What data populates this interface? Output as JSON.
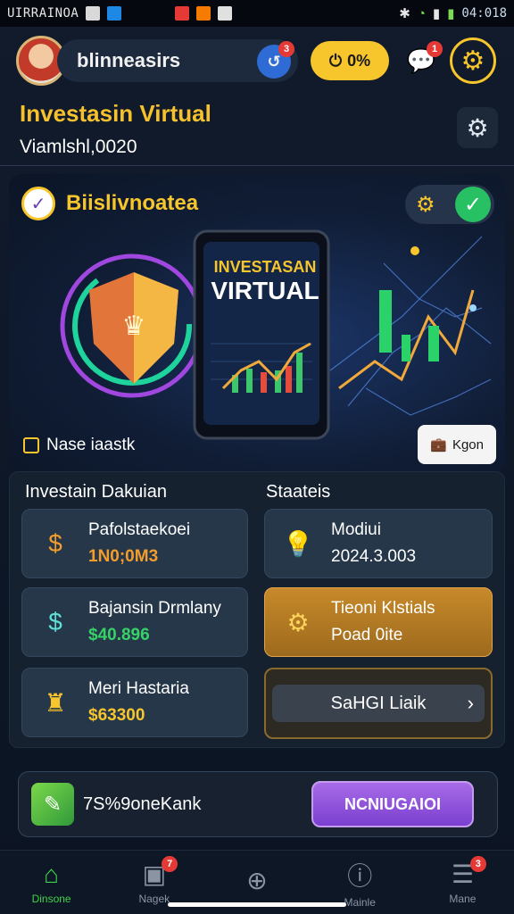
{
  "status_bar": {
    "carrier": "UIRRAINOA",
    "time": "04:018"
  },
  "header": {
    "username": "blinneasirs",
    "notif_badge": "3",
    "pill_label": "0%",
    "chat_badge": "1"
  },
  "title": {
    "main": "Investasin Virtual",
    "subtitle": "Viamlshl,0020"
  },
  "hero": {
    "title": "Biislivnoatea",
    "phone_line1": "INVESTASAN",
    "phone_line2": "VIRTUAL",
    "foot_left": "Nase iaastk",
    "foot_right": "Kgon"
  },
  "sections": {
    "left_title": "Investain Dakuian",
    "right_title": "Staateis"
  },
  "cards": [
    {
      "label": "Pafolstaekoei",
      "value": "1N0;0M3",
      "value_color": "#f29d2c"
    },
    {
      "label": "Bajansin Drmlany",
      "value": "$40.896",
      "value_color": "#37d167"
    },
    {
      "label": "Meri Hastaria",
      "value": "$63300",
      "value_color": "#f7c52c"
    },
    {
      "label": "Modiui",
      "value": "2024.3.003",
      "value_color": "#ffffff"
    },
    {
      "label": "Tieoni Klstials",
      "value": "Poad 0ite",
      "value_color": "#ffffff"
    },
    {
      "label": "SaHGI Liaik",
      "value": "",
      "value_color": "#ffffff"
    }
  ],
  "banner": {
    "text": "7S%9oneKank",
    "button": "NCNIUGAIOI"
  },
  "nav": [
    {
      "label": "Dinsone",
      "active": true
    },
    {
      "label": "Nagek",
      "badge": "7"
    },
    {
      "label": ""
    },
    {
      "label": "Mainle"
    },
    {
      "label": "Mane",
      "badge": "3"
    }
  ],
  "colors": {
    "accent_yellow": "#f7c52c",
    "accent_green": "#3ed24b",
    "cta_purple": "#8a4bd8"
  }
}
